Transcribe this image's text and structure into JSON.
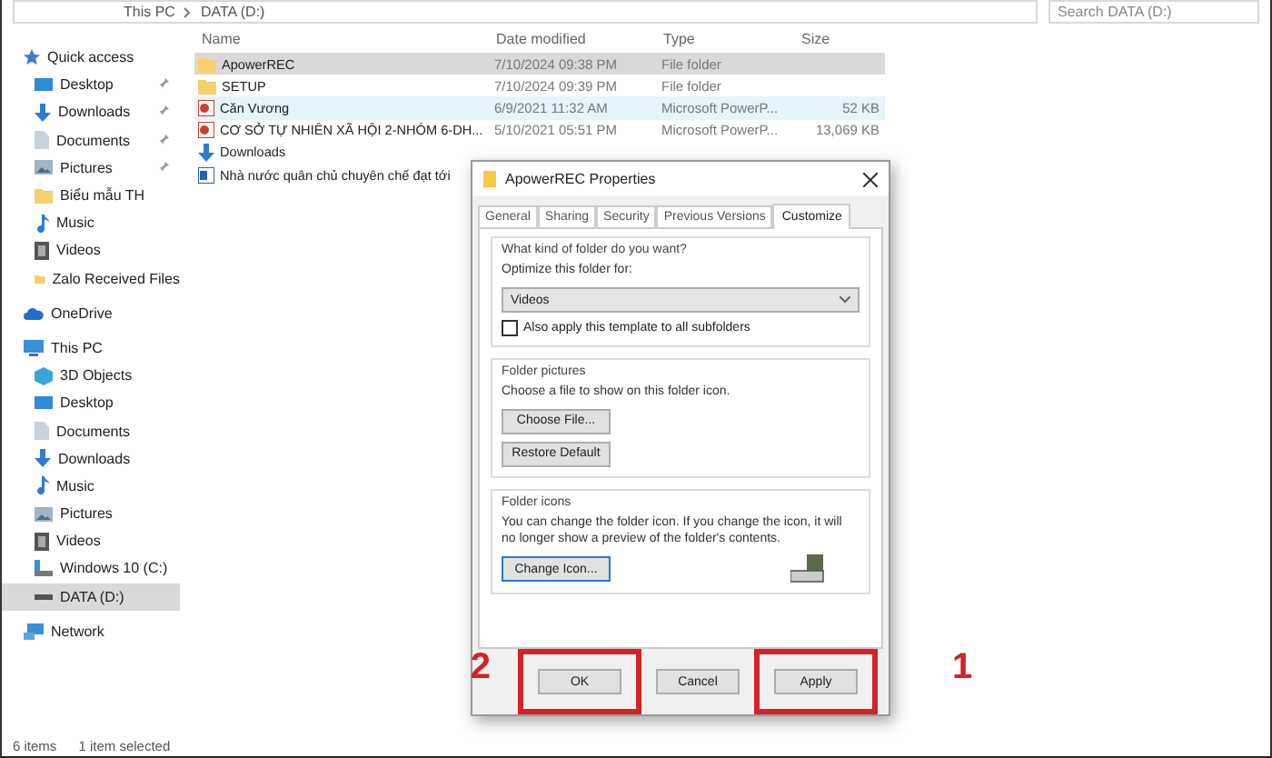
{
  "address_bar": {
    "path": [
      "This PC",
      "DATA (D:)"
    ],
    "search_placeholder": "Search DATA (D:)"
  },
  "sidebar": {
    "items": [
      {
        "label": "Quick access",
        "kind": "star",
        "selected": false,
        "children": [
          {
            "label": "Desktop",
            "kind": "desktop",
            "pinned": true,
            "selected": false
          },
          {
            "label": "Downloads",
            "kind": "download",
            "pinned": true,
            "selected": false
          },
          {
            "label": "Documents",
            "kind": "document",
            "pinned": true,
            "selected": false
          },
          {
            "label": "Pictures",
            "kind": "picture",
            "pinned": true,
            "selected": false
          },
          {
            "label": "Biểu mẫu TH",
            "kind": "folder",
            "pinned": false,
            "selected": false
          },
          {
            "label": "Music",
            "kind": "music",
            "pinned": false,
            "selected": false
          },
          {
            "label": "Videos",
            "kind": "video",
            "pinned": false,
            "selected": false
          },
          {
            "label": "Zalo Received Files",
            "kind": "folder",
            "pinned": false,
            "selected": false
          }
        ]
      },
      {
        "label": "OneDrive",
        "kind": "cloud",
        "selected": false
      },
      {
        "label": "This PC",
        "kind": "pc",
        "selected": false,
        "children": [
          {
            "label": "3D Objects",
            "kind": "cube",
            "selected": false
          },
          {
            "label": "Desktop",
            "kind": "desktop",
            "selected": false
          },
          {
            "label": "Documents",
            "kind": "document",
            "selected": false
          },
          {
            "label": "Downloads",
            "kind": "download",
            "selected": false
          },
          {
            "label": "Music",
            "kind": "music",
            "selected": false
          },
          {
            "label": "Pictures",
            "kind": "picture",
            "selected": false
          },
          {
            "label": "Videos",
            "kind": "video",
            "selected": false
          },
          {
            "label": "Windows 10 (C:)",
            "kind": "system-drive",
            "selected": false
          },
          {
            "label": "DATA (D:)",
            "kind": "drive",
            "selected": true
          }
        ]
      },
      {
        "label": "Network",
        "kind": "network",
        "selected": false
      }
    ]
  },
  "file_list": {
    "columns": [
      "Name",
      "Date modified",
      "Type",
      "Size"
    ],
    "rows": [
      {
        "name": "ApowerREC",
        "kind": "folder",
        "date": "7/10/2024 09:38 PM",
        "type": "File folder",
        "size": "",
        "selected": true,
        "hovered": false
      },
      {
        "name": "SETUP",
        "kind": "folder",
        "date": "7/10/2024 09:39 PM",
        "type": "File folder",
        "size": "",
        "selected": false,
        "hovered": false
      },
      {
        "name": "Căn Vương",
        "kind": "slides",
        "date": "6/9/2021 11:32 AM",
        "type": "Microsoft PowerP...",
        "size": "52 KB",
        "selected": false,
        "hovered": true
      },
      {
        "name": "CƠ SỞ TỰ NHIÊN XÃ HỘI 2-NHÓM 6-DH...",
        "kind": "slides",
        "date": "5/10/2021 05:51 PM",
        "type": "Microsoft PowerP...",
        "size": "13,069 KB",
        "selected": false,
        "hovered": false
      },
      {
        "name": "Downloads",
        "kind": "download",
        "date": "",
        "type": "",
        "size": "",
        "selected": false,
        "hovered": false
      },
      {
        "name": "Nhà nước quân chủ chuyên chế đạt tới",
        "kind": "doc",
        "date": "",
        "type": "",
        "size": "",
        "selected": false,
        "hovered": false
      }
    ]
  },
  "status_bar": [
    "6 items",
    "1 item selected"
  ],
  "dialog": {
    "title": "ApowerREC Properties",
    "tabs": [
      {
        "label": "General",
        "selected": false
      },
      {
        "label": "Sharing",
        "selected": false
      },
      {
        "label": "Security",
        "selected": false
      },
      {
        "label": "Previous Versions",
        "selected": false
      },
      {
        "label": "Customize",
        "selected": true
      }
    ],
    "folder_type": {
      "heading": "What kind of folder do you want?",
      "label": "Optimize this folder for:",
      "value": "Videos",
      "apply_label": "Also apply this template to all subfolders",
      "checked": false
    },
    "folder_pictures": {
      "heading": "Folder pictures",
      "text": "Choose a file to show on this folder icon.",
      "buttons": [
        "Choose File...",
        "Restore Default"
      ]
    },
    "folder_icons": {
      "heading": "Folder icons",
      "text": "You can change the folder icon. If you change the icon, it will no longer show a preview of the folder's contents.",
      "button": "Change Icon..."
    },
    "buttons": [
      {
        "label": "OK",
        "highlighted": true,
        "marker": "2"
      },
      {
        "label": "Cancel",
        "highlighted": false
      },
      {
        "label": "Apply",
        "highlighted": true,
        "marker": "1"
      }
    ]
  }
}
